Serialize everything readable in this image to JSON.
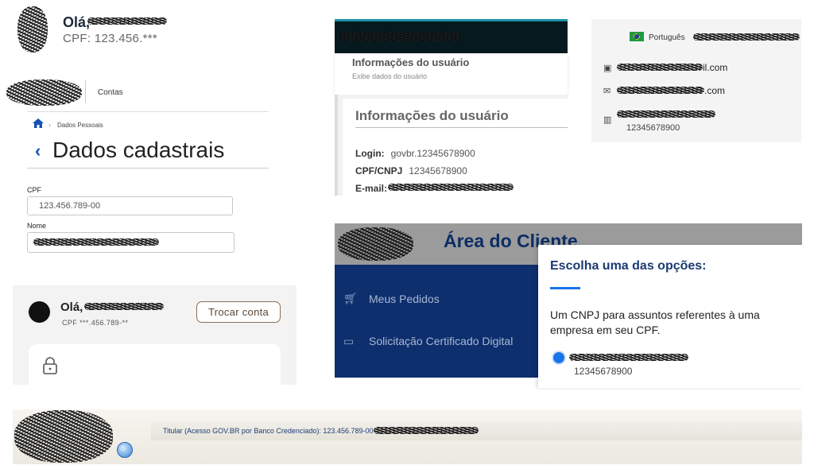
{
  "panel1": {
    "greeting": "Olá,",
    "cpf": "CPF: 123.456.***"
  },
  "panel2": {
    "menu_link": "Contas",
    "breadcrumb": "Dados Pessoais",
    "back_glyph": "‹",
    "title": "Dados cadastrais",
    "cpf_label": "CPF",
    "cpf_value": "123.456.789-00",
    "name_label": "Nome"
  },
  "panel3": {
    "greeting": "Olá,",
    "cpf": "CPF ***.456.789-**",
    "switch_button": "Trocar conta"
  },
  "panel4": {
    "header_title": "Informações do usuário",
    "header_subtitle": "Exibe dados do usuário",
    "section_title": "Informações do usuário",
    "login_label": "Login:",
    "login_value": "govbr.12345678900",
    "cpf_label": "CPF/CNPJ",
    "cpf_value": "12345678900",
    "email_label": "E-mail:"
  },
  "panel5": {
    "language": "Português",
    "email1_suffix": "il.com",
    "email2_suffix": ".com",
    "org_number": "12345678900"
  },
  "panel6": {
    "title": "Área do Cliente",
    "nav": [
      "Meus Pedidos",
      "Solicitação Certificado Digital"
    ],
    "modal_title": "Escolha uma das opções:",
    "modal_desc": "Um CNPJ para assuntos referentes à uma empresa em seu CPF.",
    "option_number": "12345678900"
  },
  "panel7": {
    "holder": "Titular (Acesso GOV.BR por Banco Credenciado): 123.456.789-00"
  },
  "colors": {
    "govbr_blue": "#1351b4",
    "client_navy": "#0e2f6e",
    "radio_blue": "#1a73e8"
  },
  "icons": [
    "home-icon",
    "chevron-left-icon",
    "lock-icon",
    "id-card-icon",
    "envelope-icon",
    "building-icon",
    "cart-icon",
    "card-icon",
    "flag-brazil-icon"
  ]
}
